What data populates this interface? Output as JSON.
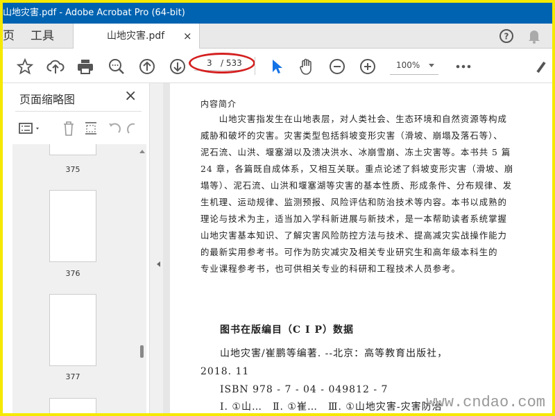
{
  "window": {
    "title": "山地灾害.pdf - Adobe Acrobat Pro (64-bit)"
  },
  "tabs": {
    "home": "页",
    "tools": "工具",
    "document": "山地灾害.pdf",
    "close": "×"
  },
  "toolbar": {
    "current_page": "3",
    "total_pages": "/ 533",
    "zoom": "100%"
  },
  "panel": {
    "title": "页面缩略图",
    "close": "×",
    "thumbnails": [
      {
        "label": "375"
      },
      {
        "label": "376"
      },
      {
        "label": "377"
      }
    ]
  },
  "document": {
    "heading": "内容简介",
    "lines": [
      "　　山地灾害指发生在山地表层，对人类社会、生态环境和自然资源等构成",
      "威胁和破坏的灾害。灾害类型包括斜坡变形灾害（滑坡、崩塌及落石等）、",
      "泥石流、山洪、堰塞湖以及溃决洪水、冰崩雪崩、冻土灾害等。本书共 5 篇",
      "24 章，各篇既自成体系，又相互关联。重点论述了斜坡变形灾害（滑坡、崩",
      "塌等）、泥石流、山洪和堰塞湖等灾害的基本性质、形成条件、分布规律、发",
      "生机理、运动规律、监测预报、风险评估和防治技术等内容。本书以成熟的",
      "理论与技术为主，适当加入学科新进展与新技术，是一本帮助读者系统掌握",
      "山地灾害基本知识、了解灾害风险防控方法与技术、提高减灾实战操作能力",
      "的最新实用参考书。可作为防灾减灾及相关专业研究生和高年级本科生的",
      "专业课程参考书，也可供相关专业的科研和工程技术人员参考。"
    ],
    "cip_title": "图书在版编目（C I P）数据",
    "cip_line1": "山地灾害/崔鹏等编著. --北京：高等教育出版社，",
    "cip_line2": "2018. 11",
    "isbn": "ISBN 978 - 7 - 04 - 049812 - 7",
    "cip_line4": "Ⅰ. ①山…　Ⅱ. ①崔…　Ⅲ. ①山地灾害-灾害防治"
  },
  "watermark": "www.cndao.com"
}
